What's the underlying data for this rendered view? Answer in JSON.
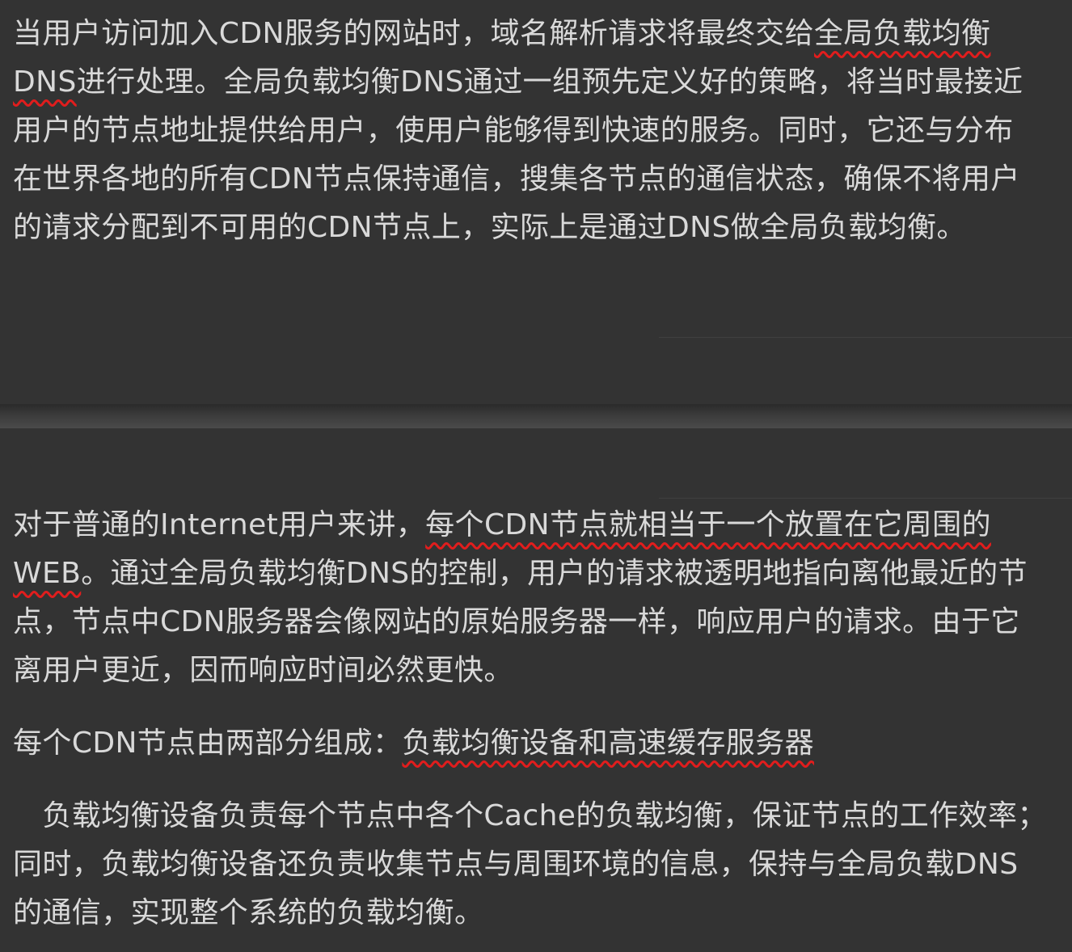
{
  "annotation_color": "#e11d1d",
  "top_page": {
    "paragraph_1": [
      {
        "plain": "当用户访问加入CDN服务的网站时，域名解析请求将最终交给",
        "marked": "全局负载均衡",
        "after": ""
      },
      {
        "plain": "",
        "marked": "DNS",
        "after": "进行处理。全局负载均衡DNS通过一组预先定义好的策略，将当时最接近"
      },
      {
        "plain": "用户的节点地址提供给用户，使用户能够得到快速的服务。同时，它还与分布",
        "marked": "",
        "after": ""
      },
      {
        "plain": "在世界各地的所有CDN节点保持通信，搜集各节点的通信状态，确保不将用户",
        "marked": "",
        "after": ""
      },
      {
        "plain": "的请求分配到不可用的CDN节点上，实际上是通过DNS做全局负载均衡。",
        "marked": "",
        "after": ""
      }
    ]
  },
  "bottom_page": {
    "paragraph_1": [
      {
        "plain": "对于普通的Internet用户来讲，",
        "marked": "每个CDN节点就相当于一个放置在它周围的",
        "after": ""
      },
      {
        "plain": "",
        "marked": "WEB",
        "after": "。通过全局负载均衡DNS的控制，用户的请求被透明地指向离他最近的节"
      },
      {
        "plain": "点，节点中CDN服务器会像网站的原始服务器一样，响应用户的请求。由于它",
        "marked": "",
        "after": ""
      },
      {
        "plain": "离用户更近，因而响应时间必然更快。",
        "marked": "",
        "after": ""
      }
    ],
    "paragraph_2": [
      {
        "plain": "每个CDN节点由两部分组成：",
        "marked": "负载均衡设备和高速缓存服务器",
        "after": ""
      }
    ],
    "paragraph_3": [
      {
        "plain": "　负载均衡设备负责每个节点中各个Cache的负载均衡，保证节点的工作效率；",
        "marked": "",
        "after": ""
      },
      {
        "plain": "同时，负载均衡设备还负责收集节点与周围环境的信息，保持与全局负载DNS",
        "marked": "",
        "after": ""
      },
      {
        "plain": "的通信，实现整个系统的负载均衡。",
        "marked": "",
        "after": ""
      }
    ]
  }
}
